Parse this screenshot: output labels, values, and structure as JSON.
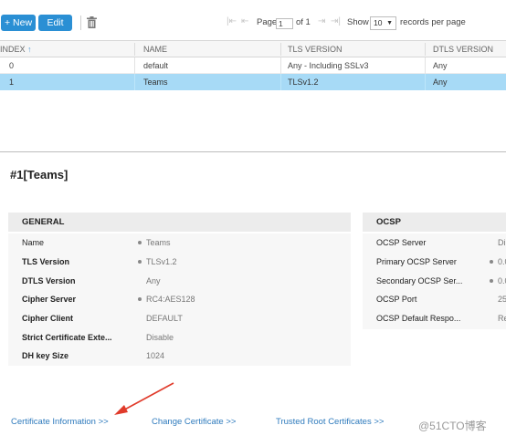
{
  "toolbar": {
    "new_label": "+ New",
    "edit_label": "Edit",
    "delete_icon": "trash-icon",
    "pager": {
      "page_label": "Page",
      "page_value": "1",
      "of_label": "of 1",
      "show_label": "Show",
      "show_value": "10",
      "records_label": "records per page"
    }
  },
  "table": {
    "columns": [
      "INDEX",
      "NAME",
      "TLS VERSION",
      "DTLS VERSION"
    ],
    "rows": [
      {
        "index": "0",
        "name": "default",
        "tls": "Any - Including SSLv3",
        "dtls": "Any"
      },
      {
        "index": "1",
        "name": "Teams",
        "tls": "TLSv1.2",
        "dtls": "Any"
      }
    ],
    "selected_color": "#a7daf6"
  },
  "detail": {
    "title": "#1[Teams]",
    "general": {
      "heading": "GENERAL",
      "rows": [
        {
          "label": "Name",
          "value": "Teams"
        },
        {
          "label": "TLS Version",
          "value": "TLSv1.2"
        },
        {
          "label": "DTLS Version",
          "value": "Any"
        },
        {
          "label": "Cipher Server",
          "value": "RC4:AES128"
        },
        {
          "label": "Cipher Client",
          "value": "DEFAULT"
        },
        {
          "label": "Strict Certificate Exte...",
          "value": "Disable"
        },
        {
          "label": "DH key Size",
          "value": "1024"
        }
      ]
    },
    "ocsp": {
      "heading": "OCSP",
      "rows": [
        {
          "label": "OCSP Server",
          "value": "Di"
        },
        {
          "label": "Primary OCSP Server",
          "value": "0.0"
        },
        {
          "label": "Secondary OCSP Ser...",
          "value": "0.0"
        },
        {
          "label": "OCSP Port",
          "value": "25"
        },
        {
          "label": "OCSP Default Respo...",
          "value": "Re"
        }
      ]
    }
  },
  "links": {
    "cert_info": "Certificate Information >>",
    "change_cert": "Change Certificate >>",
    "trusted_root": "Trusted Root Certificates >>"
  },
  "watermark": "@51CTO博客",
  "colors": {
    "accent": "#2a8fd4",
    "link": "#2f7bbd",
    "arrow": "#e03a2a"
  }
}
